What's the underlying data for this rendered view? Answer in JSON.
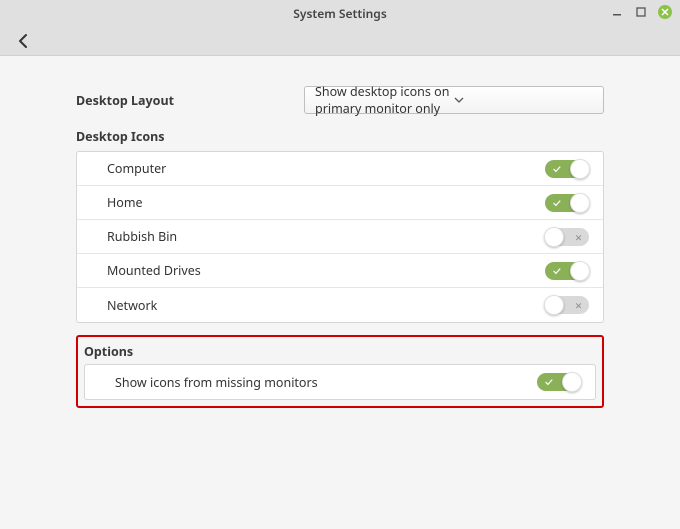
{
  "window": {
    "title": "System Settings"
  },
  "layout": {
    "label": "Desktop Layout",
    "select_value": "Show desktop icons on primary monitor only"
  },
  "icons_section": {
    "heading": "Desktop Icons",
    "items": [
      {
        "label": "Computer",
        "on": true
      },
      {
        "label": "Home",
        "on": true
      },
      {
        "label": "Rubbish Bin",
        "on": false
      },
      {
        "label": "Mounted Drives",
        "on": true
      },
      {
        "label": "Network",
        "on": false
      }
    ]
  },
  "options_section": {
    "heading": "Options",
    "items": [
      {
        "label": "Show icons from missing monitors",
        "on": true
      }
    ]
  }
}
